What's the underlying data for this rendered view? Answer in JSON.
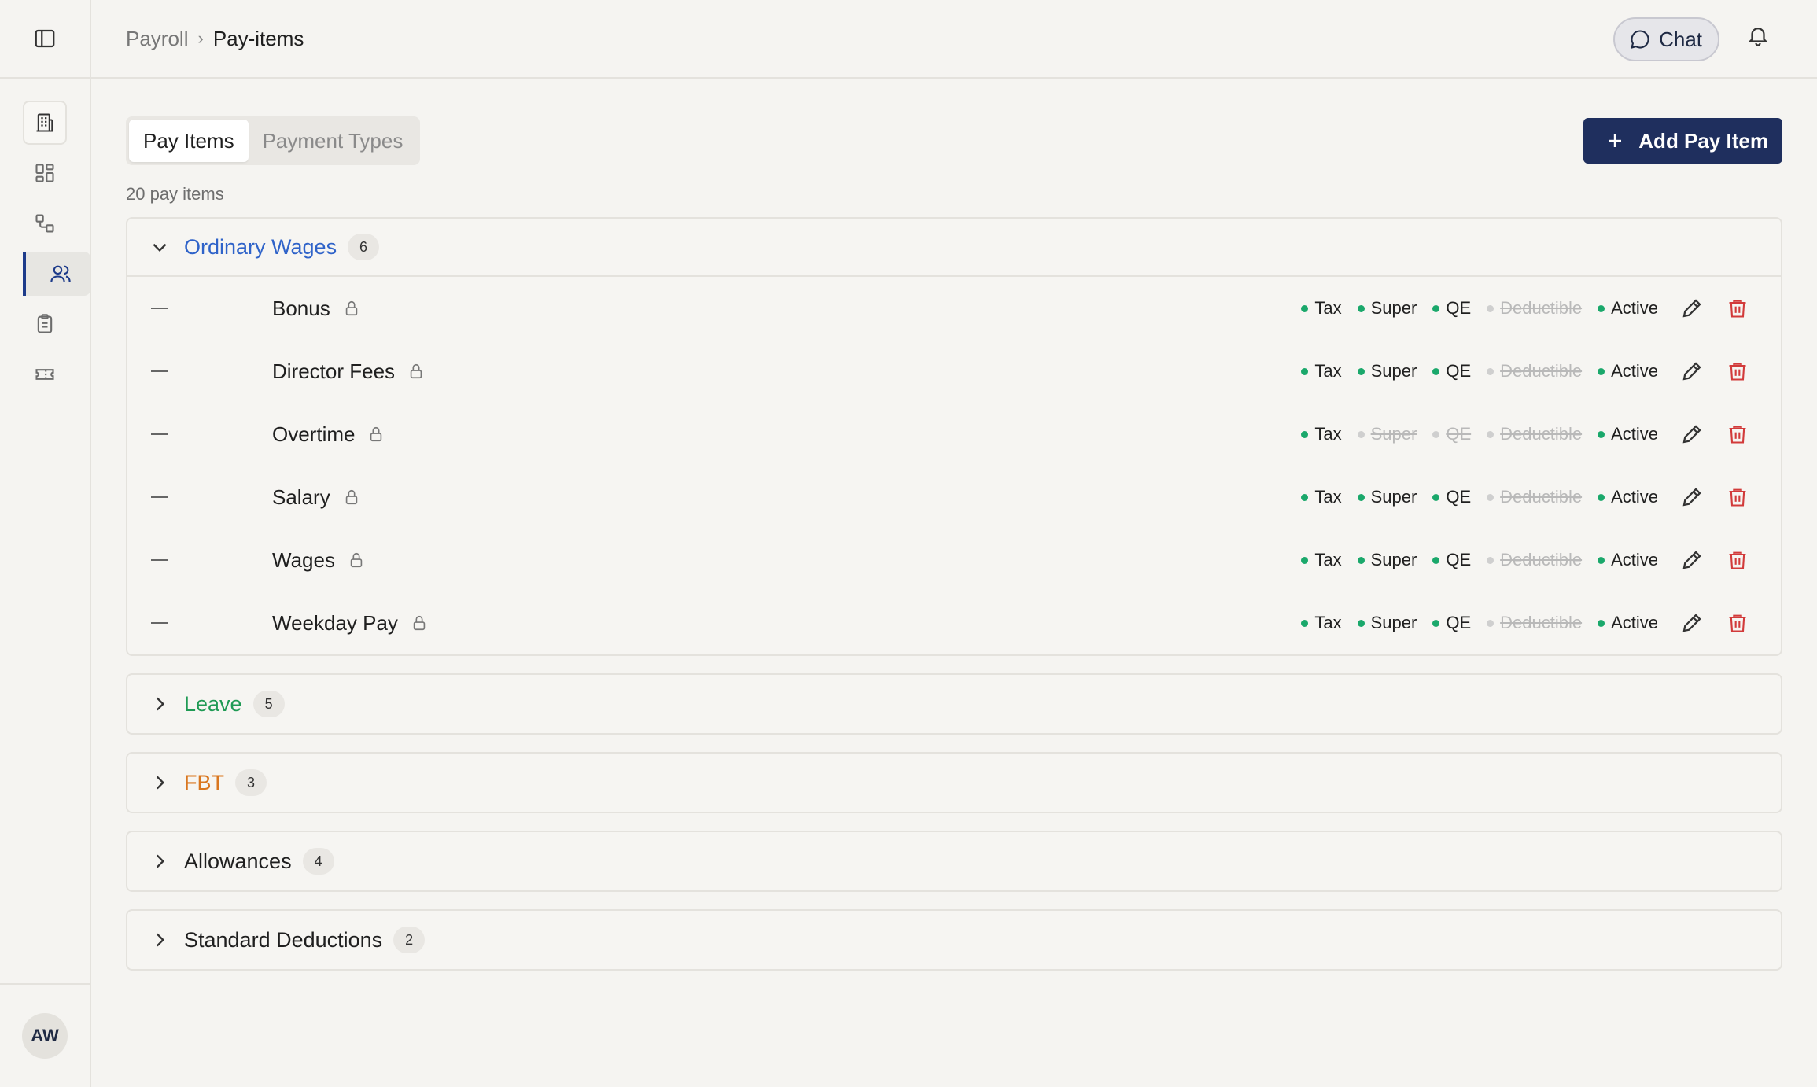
{
  "breadcrumb": {
    "parent": "Payroll",
    "separator": "›",
    "current": "Pay-items"
  },
  "header": {
    "chat_label": "Chat"
  },
  "user": {
    "initials": "AW"
  },
  "sidebar": {
    "items": [
      {
        "icon": "building-icon"
      },
      {
        "icon": "grid-icon"
      },
      {
        "icon": "workflow-icon"
      },
      {
        "icon": "users-icon",
        "active": true
      },
      {
        "icon": "clipboard-icon"
      },
      {
        "icon": "ticket-icon"
      }
    ]
  },
  "tabs": [
    {
      "label": "Pay Items",
      "active": true
    },
    {
      "label": "Payment Types",
      "active": false
    }
  ],
  "add_button_label": "Add Pay Item",
  "count_text": "20 pay items",
  "colors": {
    "ordinary": "#2f63c9",
    "leave": "#1f9a54",
    "fbt": "#d9761f",
    "default": "#1f1f1f",
    "active_dot": "#1aa86b",
    "accent": "#1f2f5e",
    "delete": "#d23a3a"
  },
  "groups": [
    {
      "title": "Ordinary Wages",
      "count": "6",
      "expanded": true,
      "color": "#2f63c9",
      "items": [
        {
          "name": "Bonus",
          "flags": [
            {
              "label": "Tax",
              "on": true
            },
            {
              "label": "Super",
              "on": true
            },
            {
              "label": "QE",
              "on": true
            },
            {
              "label": "Deductible",
              "on": false
            },
            {
              "label": "Active",
              "on": true
            }
          ]
        },
        {
          "name": "Director Fees",
          "flags": [
            {
              "label": "Tax",
              "on": true
            },
            {
              "label": "Super",
              "on": true
            },
            {
              "label": "QE",
              "on": true
            },
            {
              "label": "Deductible",
              "on": false
            },
            {
              "label": "Active",
              "on": true
            }
          ]
        },
        {
          "name": "Overtime",
          "flags": [
            {
              "label": "Tax",
              "on": true
            },
            {
              "label": "Super",
              "on": false
            },
            {
              "label": "QE",
              "on": false
            },
            {
              "label": "Deductible",
              "on": false
            },
            {
              "label": "Active",
              "on": true
            }
          ]
        },
        {
          "name": "Salary",
          "flags": [
            {
              "label": "Tax",
              "on": true
            },
            {
              "label": "Super",
              "on": true
            },
            {
              "label": "QE",
              "on": true
            },
            {
              "label": "Deductible",
              "on": false
            },
            {
              "label": "Active",
              "on": true
            }
          ]
        },
        {
          "name": "Wages",
          "flags": [
            {
              "label": "Tax",
              "on": true
            },
            {
              "label": "Super",
              "on": true
            },
            {
              "label": "QE",
              "on": true
            },
            {
              "label": "Deductible",
              "on": false
            },
            {
              "label": "Active",
              "on": true
            }
          ]
        },
        {
          "name": "Weekday Pay",
          "flags": [
            {
              "label": "Tax",
              "on": true
            },
            {
              "label": "Super",
              "on": true
            },
            {
              "label": "QE",
              "on": true
            },
            {
              "label": "Deductible",
              "on": false
            },
            {
              "label": "Active",
              "on": true
            }
          ]
        }
      ]
    },
    {
      "title": "Leave",
      "count": "5",
      "expanded": false,
      "color": "#1f9a54",
      "items": []
    },
    {
      "title": "FBT",
      "count": "3",
      "expanded": false,
      "color": "#d9761f",
      "items": []
    },
    {
      "title": "Allowances",
      "count": "4",
      "expanded": false,
      "color": "#1f1f1f",
      "items": []
    },
    {
      "title": "Standard Deductions",
      "count": "2",
      "expanded": false,
      "color": "#1f1f1f",
      "items": []
    }
  ]
}
